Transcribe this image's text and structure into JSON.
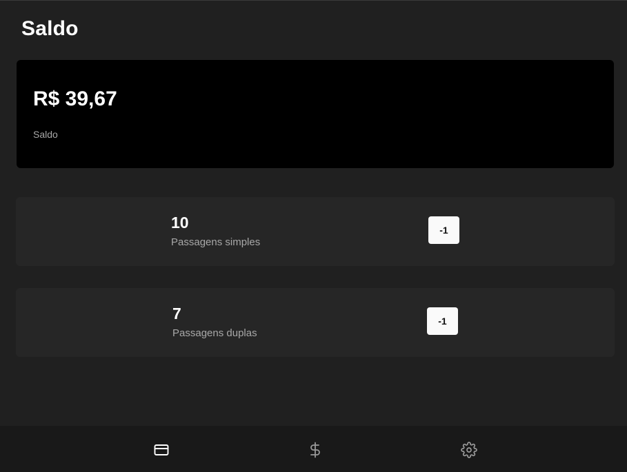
{
  "page": {
    "title": "Saldo"
  },
  "balance": {
    "amount": "R$ 39,67",
    "label": "Saldo"
  },
  "tickets": [
    {
      "count": "10",
      "label": "Passagens simples",
      "button_label": "-1"
    },
    {
      "count": "7",
      "label": "Passagens duplas",
      "button_label": "-1"
    }
  ],
  "nav": {
    "items": [
      {
        "icon": "credit-card-icon",
        "active": true
      },
      {
        "icon": "dollar-icon",
        "active": false
      },
      {
        "icon": "gear-icon",
        "active": false
      }
    ]
  },
  "colors": {
    "background": "#202020",
    "card": "#262626",
    "balance_card": "#000000",
    "nav_background": "#191919",
    "muted_text": "#a8a8a8",
    "active_icon": "#ffffff",
    "inactive_icon": "#9a9a9a"
  }
}
